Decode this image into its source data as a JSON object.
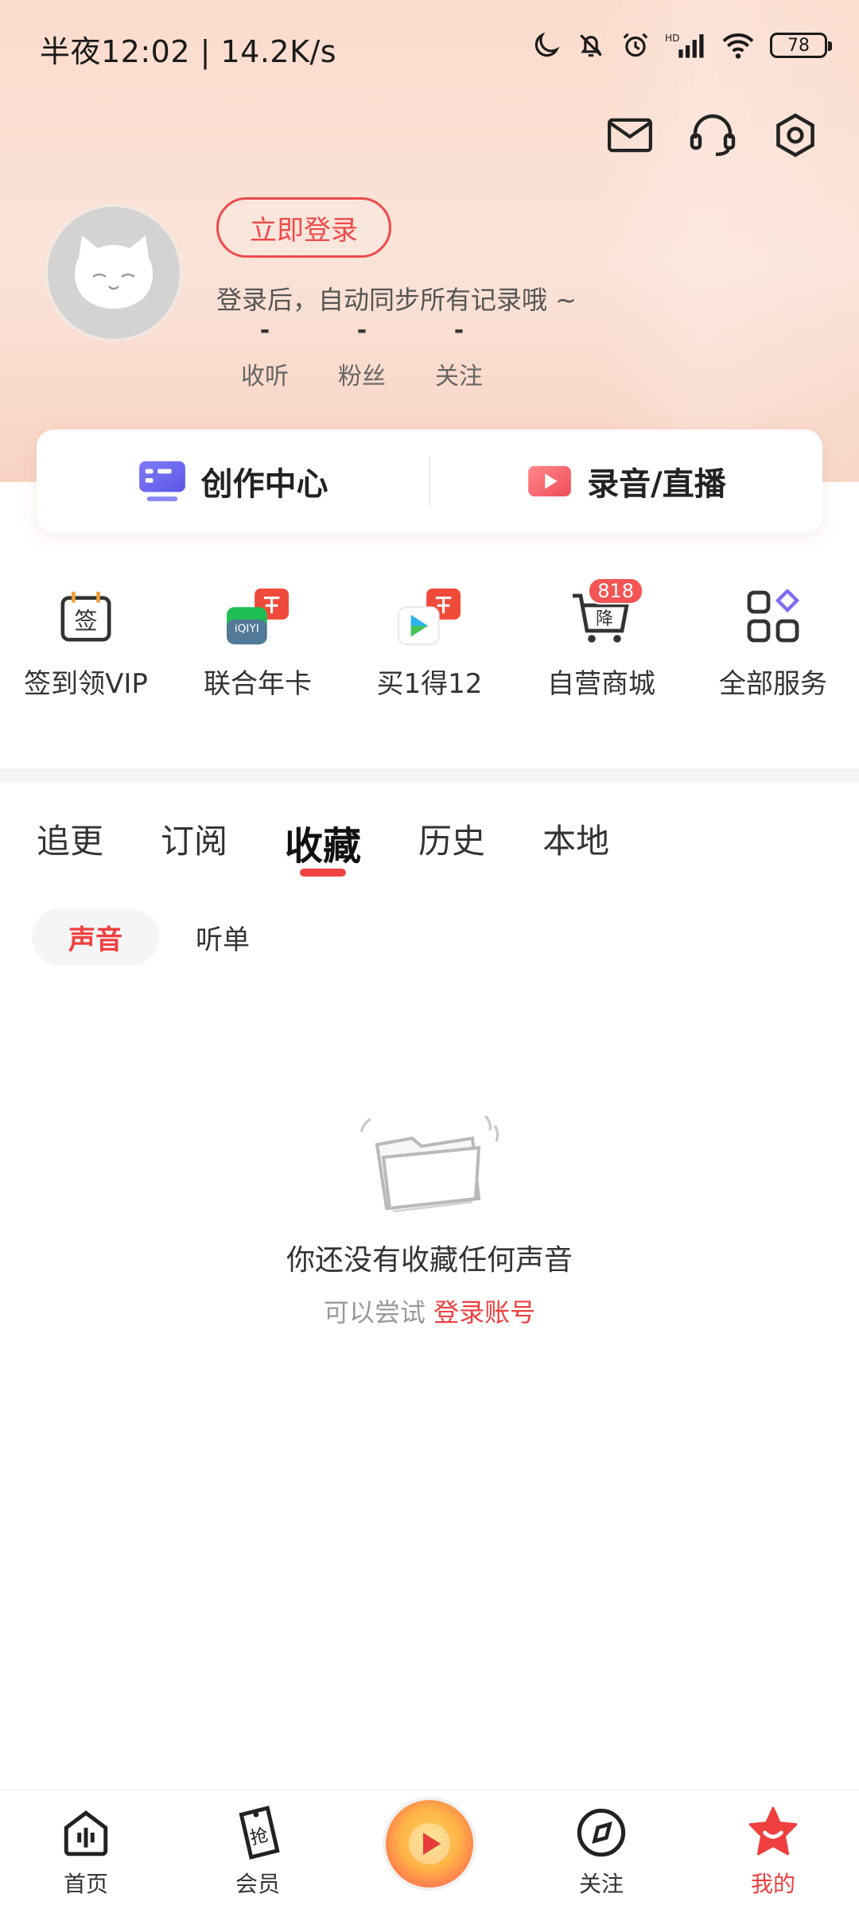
{
  "status_bar": {
    "time": "半夜12:02 | 14.2K/s",
    "battery": "78"
  },
  "profile": {
    "login_button": "立即登录",
    "login_tip": "登录后，自动同步所有记录哦 ~",
    "stats": [
      {
        "value": "-",
        "label": "收听"
      },
      {
        "value": "-",
        "label": "粉丝"
      },
      {
        "value": "-",
        "label": "关注"
      }
    ]
  },
  "creator": {
    "center_label": "创作中心",
    "record_label": "录音/直播"
  },
  "services": [
    {
      "label": "签到领VIP",
      "icon": "sign-in-icon",
      "glyph": "签"
    },
    {
      "label": "联合年卡",
      "icon": "iqiyi-card-icon"
    },
    {
      "label": "买1得12",
      "icon": "buy-one-get-twelve-icon"
    },
    {
      "label": "自营商城",
      "icon": "mall-cart-icon",
      "badge": "818",
      "glyph": "降"
    },
    {
      "label": "全部服务",
      "icon": "all-services-icon"
    }
  ],
  "tabs": [
    "追更",
    "订阅",
    "收藏",
    "历史",
    "本地"
  ],
  "active_tab": "收藏",
  "subtabs": [
    "声音",
    "听单"
  ],
  "empty_state": {
    "title": "你还没有收藏任何声音",
    "sub_prefix": "可以尝试",
    "sub_link": "登录账号"
  },
  "bottom_nav": [
    {
      "label": "首页"
    },
    {
      "label": "会员"
    },
    {
      "label": ""
    },
    {
      "label": "关注"
    },
    {
      "label": "我的"
    }
  ],
  "colors": {
    "accent": "#ef3f3f",
    "header_bg": "#fbdccd"
  }
}
